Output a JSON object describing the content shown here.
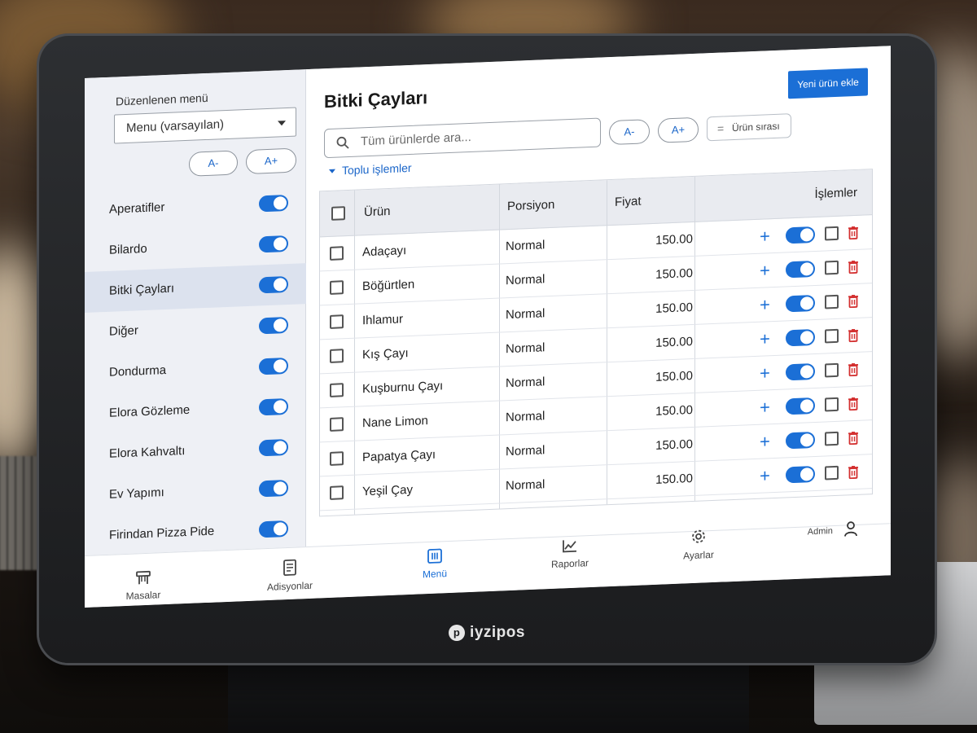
{
  "sidebar": {
    "menu_label": "Düzenlenen menü",
    "menu_select_value": "Menu (varsayılan)",
    "font_decrease": "A-",
    "font_increase": "A+",
    "categories": [
      {
        "label": "Aperatifler",
        "enabled": true
      },
      {
        "label": "Bilardo",
        "enabled": true
      },
      {
        "label": "Bitki Çayları",
        "enabled": true,
        "active": true
      },
      {
        "label": "Diğer",
        "enabled": true
      },
      {
        "label": "Dondurma",
        "enabled": true
      },
      {
        "label": "Elora Gözleme",
        "enabled": true
      },
      {
        "label": "Elora Kahvaltı",
        "enabled": true
      },
      {
        "label": "Ev Yapımı",
        "enabled": true
      },
      {
        "label": "Firindan Pizza Pide",
        "enabled": true
      }
    ]
  },
  "main": {
    "title": "Bitki Çayları",
    "new_product_button": "Yeni ürün ekle",
    "search_placeholder": "Tüm ürünlerde ara...",
    "font_decrease": "A-",
    "font_increase": "A+",
    "sort_button": "Ürün sırası",
    "bulk_actions": "Toplu işlemler",
    "table": {
      "headers": {
        "product": "Ürün",
        "portion": "Porsiyon",
        "price": "Fiyat",
        "actions": "İşlemler"
      },
      "rows": [
        {
          "product": "Adaçayı",
          "portion": "Normal",
          "price": "150.00"
        },
        {
          "product": "Böğürtlen",
          "portion": "Normal",
          "price": "150.00"
        },
        {
          "product": "Ihlamur",
          "portion": "Normal",
          "price": "150.00"
        },
        {
          "product": "Kış Çayı",
          "portion": "Normal",
          "price": "150.00"
        },
        {
          "product": "Kuşburnu Çayı",
          "portion": "Normal",
          "price": "150.00"
        },
        {
          "product": "Nane Limon",
          "portion": "Normal",
          "price": "150.00"
        },
        {
          "product": "Papatya Çayı",
          "portion": "Normal",
          "price": "150.00"
        },
        {
          "product": "Yeşil Çay",
          "portion": "Normal",
          "price": "150.00"
        }
      ]
    }
  },
  "nav": {
    "items": [
      {
        "label": "Masalar",
        "icon": "table-icon"
      },
      {
        "label": "Adisyonlar",
        "icon": "receipt-icon"
      },
      {
        "label": "Menü",
        "icon": "menu-grid-icon",
        "active": true
      },
      {
        "label": "Raporlar",
        "icon": "chart-icon"
      },
      {
        "label": "Ayarlar",
        "icon": "gear-icon"
      }
    ],
    "user": "Admin"
  },
  "device_brand": "iyzipos",
  "colors": {
    "accent": "#1b6fd6",
    "danger": "#d32f2f",
    "sidebar_bg": "#eef0f5",
    "active_row": "#dce2ee"
  }
}
